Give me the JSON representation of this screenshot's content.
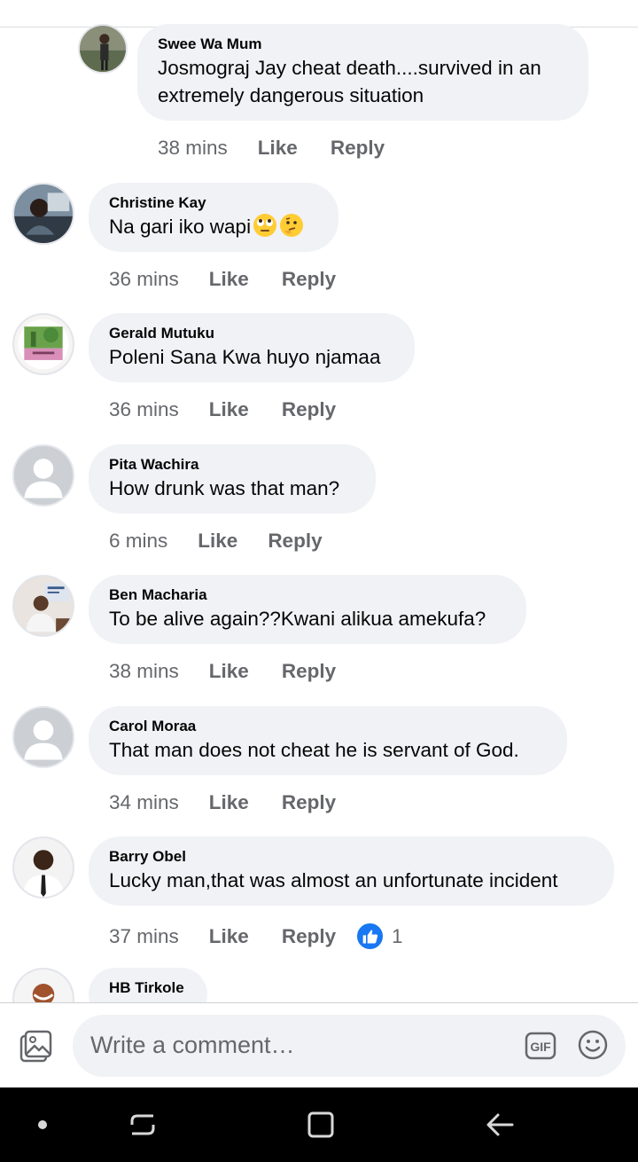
{
  "comments": [
    {
      "author": "Swee Wa Mum",
      "text": "Josmograj Jay cheat death....survived in an extremely dangerous situation",
      "time": "38 mins",
      "avatar": "photo-woman-standing"
    },
    {
      "author": "Christine Kay",
      "text": "Na gari iko wapi",
      "time": "36 mins",
      "emojis": [
        "eye-roll-emoji",
        "thinking-emoji"
      ],
      "avatar": "photo-woman-car"
    },
    {
      "author": "Gerald Mutuku",
      "text": "Poleni Sana Kwa huyo njamaa",
      "time": "36 mins",
      "avatar": "photo-garden"
    },
    {
      "author": "Pita Wachira",
      "text": "How drunk was that man?",
      "time": "6 mins",
      "avatar": "default-avatar"
    },
    {
      "author": "Ben Macharia",
      "text": "To be alive again??Kwani alikua amekufa?",
      "time": "38 mins",
      "avatar": "photo-man-office"
    },
    {
      "author": "Carol Moraa",
      "text": "That man does not cheat he is servant of God.",
      "time": "34 mins",
      "avatar": "default-avatar"
    },
    {
      "author": "Barry Obel",
      "text": "Lucky man,that was almost an unfortunate incident",
      "time": "37 mins",
      "reaction_count": "1",
      "reaction": "like-reaction",
      "avatar": "photo-man-suit"
    },
    {
      "author": "HB Tirkole",
      "avatar": "photo-man-smiling"
    }
  ],
  "actions": {
    "like": "Like",
    "reply": "Reply"
  },
  "composer": {
    "placeholder": "Write a comment…",
    "gif_label": "GIF"
  },
  "colors": {
    "bubble": "#f0f2f5",
    "meta_text": "#65676b",
    "like_blue": "#1877f2",
    "nav_bar": "#000000"
  }
}
